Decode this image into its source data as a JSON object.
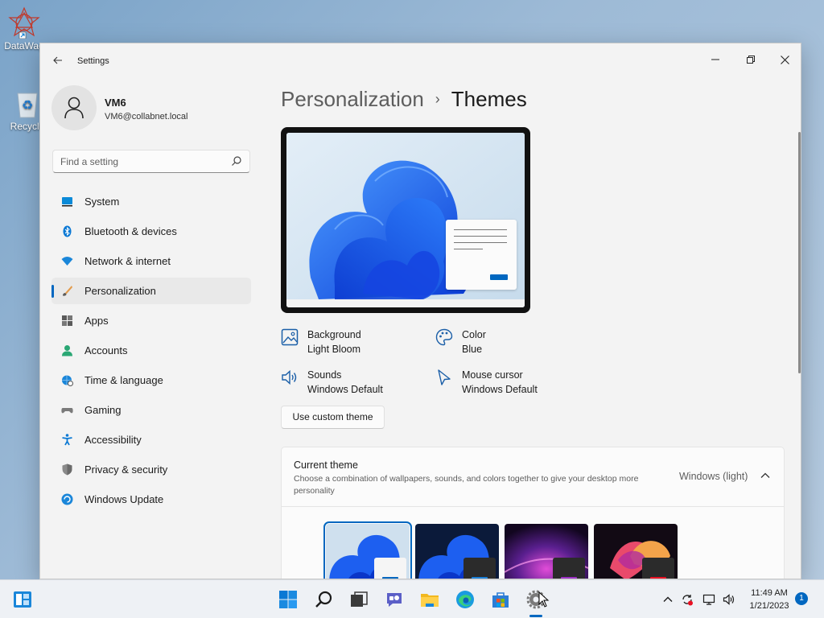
{
  "desktop": {
    "icons": [
      {
        "label": "DataWag",
        "icon": "datawag-icon"
      },
      {
        "label": "Recycle",
        "icon": "recycle-bin-icon"
      }
    ]
  },
  "window": {
    "title": "Settings",
    "controls": {
      "minimize": "minimize-icon",
      "maximize": "restore-icon",
      "close": "close-icon"
    }
  },
  "profile": {
    "name": "VM6",
    "email": "VM6@collabnet.local"
  },
  "search": {
    "placeholder": "Find a setting"
  },
  "sidebar": {
    "items": [
      {
        "label": "System",
        "icon": "system-icon",
        "color": "#0078d4"
      },
      {
        "label": "Bluetooth & devices",
        "icon": "bluetooth-icon",
        "color": "#0078d4"
      },
      {
        "label": "Network & internet",
        "icon": "wifi-icon",
        "color": "#0078d4"
      },
      {
        "label": "Personalization",
        "icon": "brush-icon",
        "color": "#d17c3f",
        "active": true
      },
      {
        "label": "Apps",
        "icon": "apps-icon",
        "color": "#555555"
      },
      {
        "label": "Accounts",
        "icon": "accounts-icon",
        "color": "#2aa774"
      },
      {
        "label": "Time & language",
        "icon": "globe-clock-icon",
        "color": "#0078d4"
      },
      {
        "label": "Gaming",
        "icon": "gamepad-icon",
        "color": "#7a7a7a"
      },
      {
        "label": "Accessibility",
        "icon": "accessibility-icon",
        "color": "#0078d4"
      },
      {
        "label": "Privacy & security",
        "icon": "shield-icon",
        "color": "#7a7a7a"
      },
      {
        "label": "Windows Update",
        "icon": "update-icon",
        "color": "#0078d4"
      }
    ]
  },
  "breadcrumb": {
    "parent": "Personalization",
    "separator": "›",
    "current": "Themes"
  },
  "theme_attrs": {
    "background": {
      "title": "Background",
      "value": "Light Bloom",
      "icon": "picture-icon"
    },
    "color": {
      "title": "Color",
      "value": "Blue",
      "icon": "palette-icon"
    },
    "sounds": {
      "title": "Sounds",
      "value": "Windows Default",
      "icon": "speaker-icon"
    },
    "cursor": {
      "title": "Mouse cursor",
      "value": "Windows Default",
      "icon": "cursor-icon"
    }
  },
  "custom_theme_button": "Use custom theme",
  "current_theme": {
    "title": "Current theme",
    "description": "Choose a combination of wallpapers, sounds, and colors together to give your desktop more personality",
    "value": "Windows (light)"
  },
  "theme_thumbnails": [
    {
      "name": "windows-light-theme-thumbnail",
      "selected": true
    },
    {
      "name": "windows-dark-theme-thumbnail"
    },
    {
      "name": "glow-theme-thumbnail"
    },
    {
      "name": "captured-motion-theme-thumbnail"
    }
  ],
  "taskbar": {
    "icons": [
      "start-icon",
      "search-icon",
      "task-view-icon",
      "chat-icon",
      "file-explorer-icon",
      "edge-icon",
      "store-icon",
      "settings-icon"
    ],
    "tray": [
      "chevron-up-icon",
      "sync-icon",
      "network-icon",
      "volume-icon"
    ],
    "time": "11:49 AM",
    "date": "1/21/2023",
    "notification_count": "1"
  },
  "colors": {
    "accent": "#0067c0",
    "window_bg": "#f3f3f3"
  }
}
